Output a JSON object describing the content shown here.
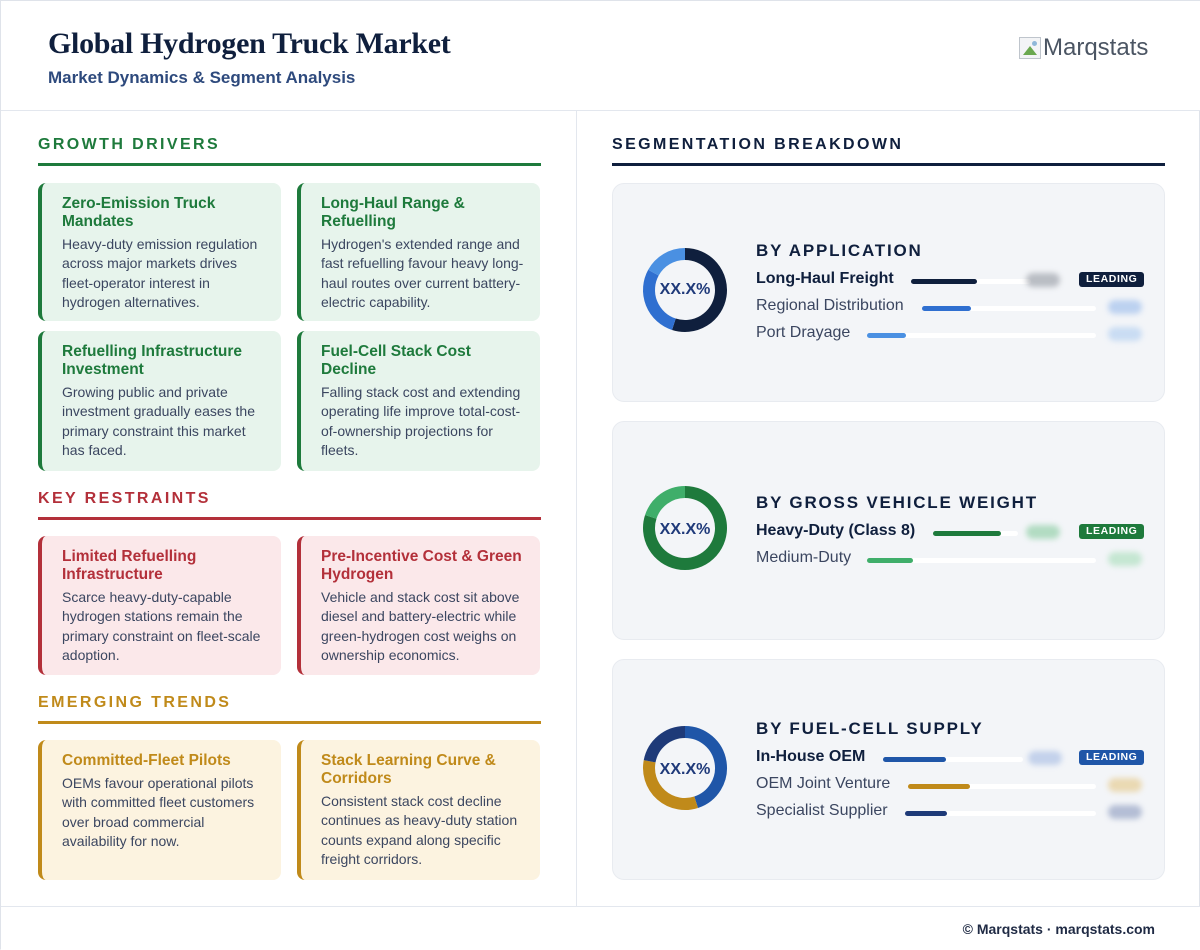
{
  "header": {
    "title": "Global Hydrogen Truck Market",
    "subtitle": "Market Dynamics & Segment Analysis",
    "logo_text": "Marqstats"
  },
  "growth": {
    "heading": "GROWTH DRIVERS",
    "cards": [
      {
        "title": "Zero-Emission Truck Mandates",
        "body": "Heavy-duty emission regulation across major markets drives fleet-operator interest in hydrogen alternatives."
      },
      {
        "title": "Long-Haul Range & Refuelling",
        "body": "Hydrogen's extended range and fast refuelling favour heavy long-haul routes over current battery-electric capability."
      },
      {
        "title": "Refuelling Infrastructure Investment",
        "body": "Growing public and private investment gradually eases the primary constraint this market has faced."
      },
      {
        "title": "Fuel-Cell Stack Cost Decline",
        "body": "Falling stack cost and extending operating life improve total-cost-of-ownership projections for fleets."
      }
    ]
  },
  "restraints": {
    "heading": "KEY RESTRAINTS",
    "cards": [
      {
        "title": "Limited Refuelling Infrastructure",
        "body": "Scarce heavy-duty-capable hydrogen stations remain the primary constraint on fleet-scale adoption."
      },
      {
        "title": "Pre-Incentive Cost & Green Hydrogen",
        "body": "Vehicle and stack cost sit above diesel and battery-electric while green-hydrogen cost weighs on ownership economics."
      }
    ]
  },
  "trends": {
    "heading": "EMERGING TRENDS",
    "cards": [
      {
        "title": "Committed-Fleet Pilots",
        "body": "OEMs favour operational pilots with committed fleet customers over broad commercial availability for now."
      },
      {
        "title": "Stack Learning Curve & Corridors",
        "body": "Consistent stack cost decline continues as heavy-duty station counts expand along specific freight corridors."
      }
    ]
  },
  "segmentation": {
    "heading": "SEGMENTATION BREAKDOWN",
    "badge": "LEADING",
    "segments": [
      {
        "title": "BY APPLICATION",
        "donut_label": "XX.X%",
        "rows": [
          {
            "label": "Long-Haul Freight",
            "share": 0.55,
            "color": "#0f1f3d",
            "leading": true
          },
          {
            "label": "Regional Distribution",
            "share": 0.28,
            "color": "#2f6fd0",
            "leading": false
          },
          {
            "label": "Port Drayage",
            "share": 0.17,
            "color": "#4a90e2",
            "leading": false
          }
        ]
      },
      {
        "title": "BY GROSS VEHICLE WEIGHT",
        "donut_label": "XX.X%",
        "rows": [
          {
            "label": "Heavy-Duty (Class 8)",
            "share": 0.8,
            "color": "#1e7a3c",
            "leading": true
          },
          {
            "label": "Medium-Duty",
            "share": 0.2,
            "color": "#3fae6a",
            "leading": false
          }
        ]
      },
      {
        "title": "BY FUEL-CELL SUPPLY",
        "donut_label": "XX.X%",
        "rows": [
          {
            "label": "In-House OEM",
            "share": 0.45,
            "color": "#1f56a8",
            "leading": true
          },
          {
            "label": "OEM Joint Venture",
            "share": 0.33,
            "color": "#c08a1a",
            "leading": false
          },
          {
            "label": "Specialist Supplier",
            "share": 0.22,
            "color": "#1e3a78",
            "leading": false
          }
        ]
      }
    ]
  },
  "footer": {
    "text": "© Marqstats · marqstats.com"
  }
}
